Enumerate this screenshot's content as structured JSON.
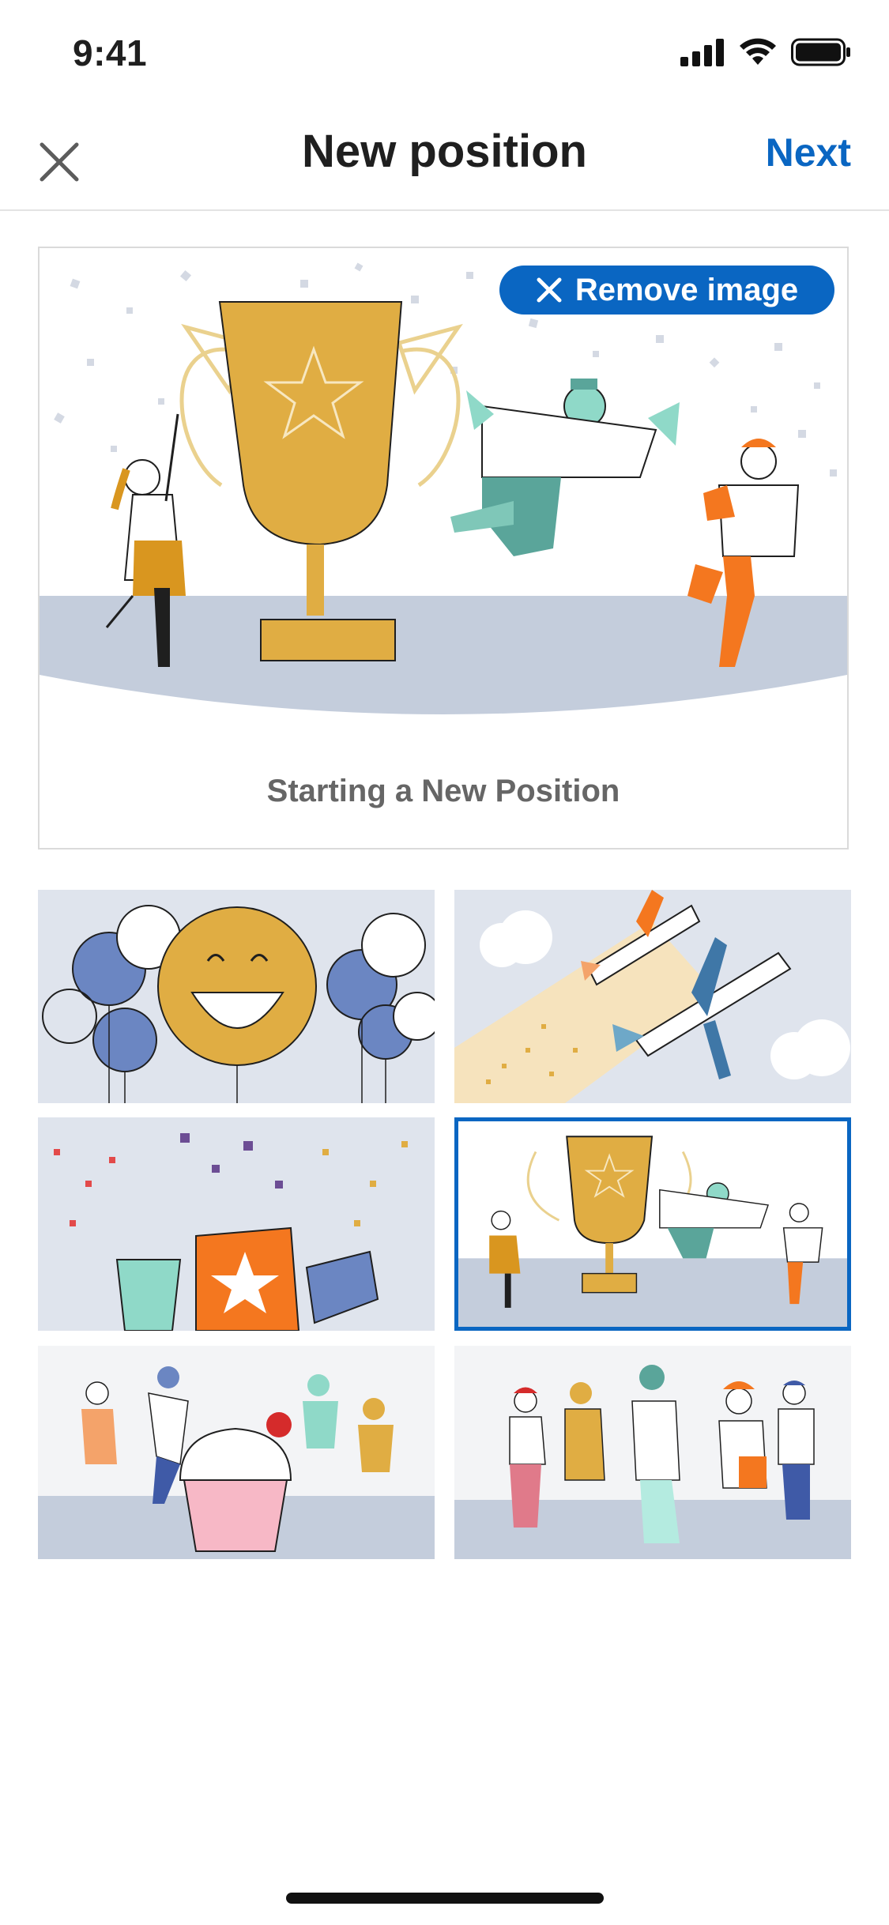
{
  "status_bar": {
    "time": "9:41"
  },
  "header": {
    "title": "New position",
    "next_label": "Next"
  },
  "preview": {
    "remove_label": "Remove image",
    "caption": "Starting a New Position"
  },
  "thumbnails": [
    {
      "name": "balloons-smiley",
      "selected": false
    },
    {
      "name": "airplanes",
      "selected": false
    },
    {
      "name": "confetti-gifts",
      "selected": false
    },
    {
      "name": "trophy-celebration",
      "selected": true
    },
    {
      "name": "cupcake-party",
      "selected": false
    },
    {
      "name": "group-clapping",
      "selected": false
    }
  ],
  "colors": {
    "accent": "#0a66c2",
    "gold": "#e0ad43",
    "slate": "#c3ccdc",
    "orange": "#f4771f",
    "teal": "#5aa59a"
  }
}
